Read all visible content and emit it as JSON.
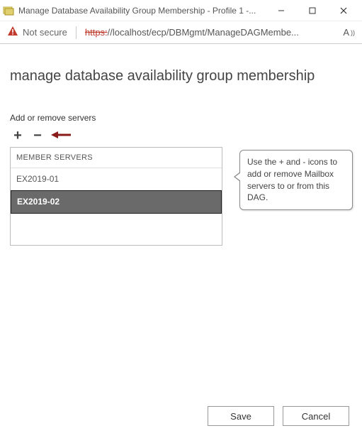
{
  "window": {
    "title": "Manage Database Availability Group Membership - Profile 1 -..."
  },
  "addressbar": {
    "not_secure": "Not secure",
    "url_strike": "https:",
    "url_rest": "//localhost/ecp/DBMgmt/ManageDAGMembe...",
    "reader_label": "A"
  },
  "page": {
    "heading": "manage database availability group membership",
    "section_label": "Add or remove servers"
  },
  "members": {
    "header": "MEMBER SERVERS",
    "items": [
      {
        "name": "EX2019-01",
        "selected": false
      },
      {
        "name": "EX2019-02",
        "selected": true
      }
    ]
  },
  "callout": {
    "text": "Use the + and - icons to add or remove Mailbox servers to or from this DAG."
  },
  "footer": {
    "save": "Save",
    "cancel": "Cancel"
  }
}
